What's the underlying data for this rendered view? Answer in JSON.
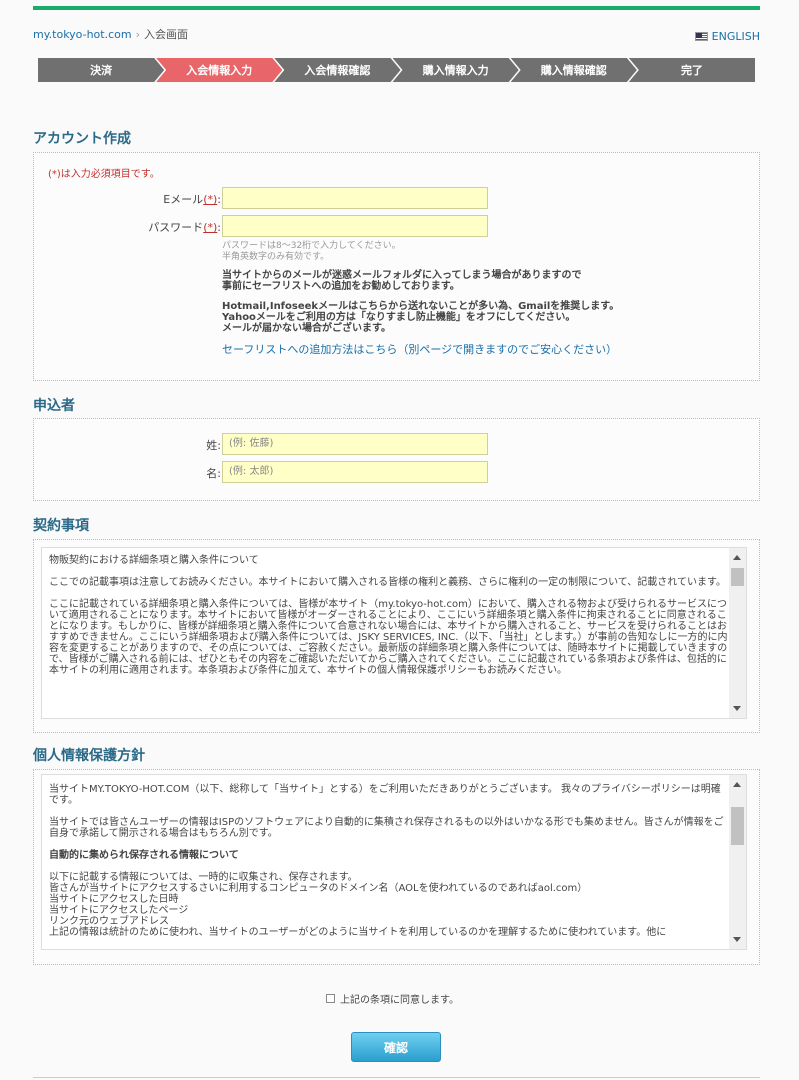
{
  "breadcrumb": {
    "home": "my.tokyo-hot.com",
    "sep": "›",
    "current": "入会画面"
  },
  "lang_link": "ENGLISH",
  "steps": [
    "決済",
    "入会情報入力",
    "入会情報確認",
    "購入情報入力",
    "購入情報確認",
    "完了"
  ],
  "active_step": 1,
  "account": {
    "title": "アカウント作成",
    "required_note": "(*)は入力必須項目です。",
    "email_label": "Eメール",
    "password_label": "パスワード",
    "required_mark": "(*)",
    "colon": ":",
    "email_value": "",
    "password_value": "",
    "password_hint_1": "パスワードは8～32桁で入力してください。",
    "password_hint_2": "半角英数字のみ有効です。",
    "note_1a": "当サイトからのメールが迷惑メールフォルダに入ってしまう場合がありますので",
    "note_1b": "事前にセーフリストへの追加をお勧めしております。",
    "note_2a": "Hotmail,Infoseekメールはこちらから送れないことが多い為、Gmailを推奨します。",
    "note_2b": "Yahooメールをご利用の方は「なりすまし防止機能」をオフにしてください。",
    "note_2c": "メールが届かない場合がございます。",
    "safelist_link": "セーフリストへの追加方法はこちら（別ページで開きますのでご安心ください）"
  },
  "applicant": {
    "title": "申込者",
    "last_label": "姓:",
    "first_label": "名:",
    "last_placeholder": "(例: 佐藤)",
    "first_placeholder": "(例: 太郎)"
  },
  "terms": {
    "title": "契約事項",
    "p1": "物販契約における詳細条項と購入条件について",
    "p2": "ここでの記載事項は注意してお読みください。本サイトにおいて購入される皆様の権利と義務、さらに権利の一定の制限について、記載されています。",
    "p3": "ここに記載されている詳細条項と購入条件については、皆様が本サイト（my.tokyo-hot.com）において、購入される物および受けられるサービスについて適用されることになります。本サイトにおいて皆様がオーダーされることにより、ここにいう詳細条項と購入条件に拘束されることに同意されることになります。もしかりに、皆様が詳細条項と購入条件について合意されない場合には、本サイトから購入されること、サービスを受けられることはおすすめできません。ここにいう詳細条項および購入条件については、JSKY SERVICES, INC.（以下、「当社」とします。）が事前の告知なしに一方的に内容を変更することがありますので、その点については、ご容赦ください。最新版の詳細条項と購入条件については、随時本サイトに掲載していきますので、皆様がご購入される前には、ぜひともその内容をご確認いただいてからご購入されてください。ここに記載されている条項および条件は、包括的に本サイトの利用に適用されます。本条項および条件に加えて、本サイトの個人情報保護ポリシーもお読みください。"
  },
  "privacy": {
    "title": "個人情報保護方針",
    "p1": "当サイトMY.TOKYO-HOT.COM（以下、総称して「当サイト」とする）をご利用いただきありがとうございます。 我々のプライバシーポリシーは明確です。",
    "p2": "当サイトでは皆さんユーザーの情報はISPのソフトウェアにより自動的に集積され保存されるもの以外はいかなる形でも集めません。皆さんが情報をご自身で承諾して開示される場合はもちろん別です。",
    "h1": "自動的に集められ保存される情報について",
    "p3": "以下に記載する情報については、一時的に収集され、保存されます。",
    "l1": "皆さんが当サイトにアクセスするさいに利用するコンピュータのドメイン名（AOLを使われているのであればaol.com）",
    "l2": "当サイトにアクセスした日時",
    "l3": "当サイトにアクセスしたページ",
    "l4": "リンク元のウェブアドレス",
    "l5": "上記の情報は統計のために使われ、当サイトのユーザーがどのように当サイトを利用しているのかを理解するために使われています。他に"
  },
  "agree_label": "上記の条項に同意します。",
  "confirm_button": "確認",
  "colors": {
    "accent_green": "#1aab6d",
    "active_step": "#e8656a",
    "step": "#707070",
    "title": "#2a6a88",
    "input_bg": "#ffffc8"
  }
}
